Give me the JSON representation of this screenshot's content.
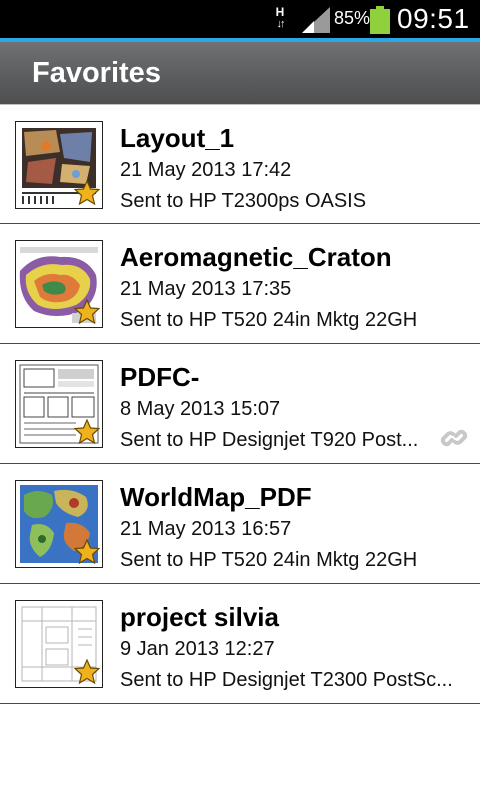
{
  "status_bar": {
    "network": "H",
    "battery_percent": "85%",
    "time": "09:51",
    "battery_level": 0.85
  },
  "action_bar": {
    "title": "Favorites"
  },
  "items": [
    {
      "name": "Layout_1",
      "date": "21 May 2013 17:42",
      "sent": "Sent to HP T2300ps OASIS",
      "favorite": true,
      "icon": "map-thumbnail",
      "linked": false
    },
    {
      "name": "Aeromagnetic_Craton",
      "date": "21 May 2013 17:35",
      "sent": "Sent to HP T520 24in Mktg 22GH",
      "favorite": true,
      "icon": "geology-map-thumbnail",
      "linked": false
    },
    {
      "name": "PDFC-",
      "date": "8 May 2013 15:07",
      "sent": "Sent to HP Designjet T920 Post...",
      "favorite": true,
      "icon": "drawing-thumbnail",
      "linked": true
    },
    {
      "name": "WorldMap_PDF",
      "date": "21 May 2013 16:57",
      "sent": "Sent to HP T520 24in Mktg 22GH",
      "favorite": true,
      "icon": "world-map-thumbnail",
      "linked": false
    },
    {
      "name": "project silvia",
      "date": "9 Jan 2013 12:27",
      "sent": "Sent to HP Designjet T2300 PostSc...",
      "favorite": true,
      "icon": "floorplan-thumbnail",
      "linked": false
    }
  ],
  "colors": {
    "accent": "#2aa7e6",
    "star": "#f0b21c",
    "battery": "#8fd13c"
  }
}
